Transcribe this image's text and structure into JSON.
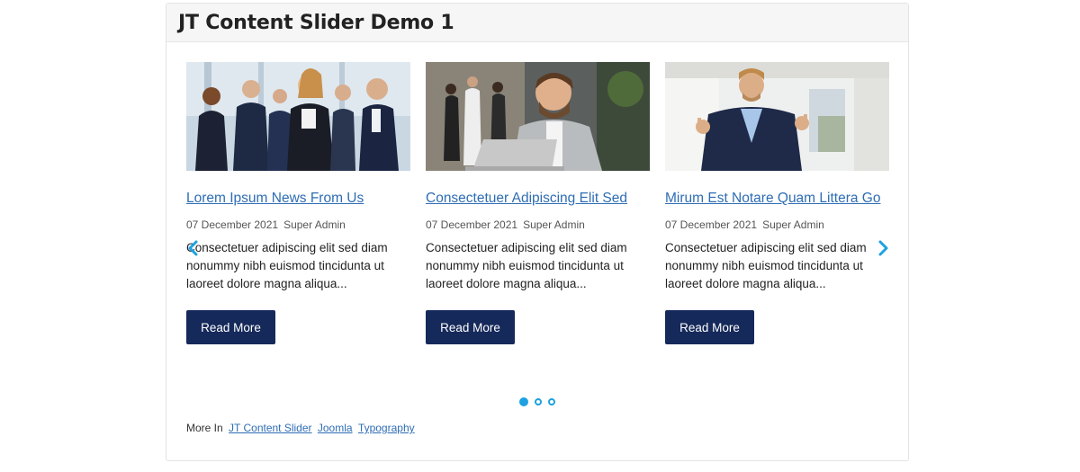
{
  "module": {
    "title": "JT Content Slider Demo 1"
  },
  "slides": [
    {
      "title": "Lorem Ipsum News From Us",
      "date": "07 December 2021",
      "author": "Super Admin",
      "text": "Consectetuer adipiscing elit sed diam nonummy nibh euismod tincidunta ut laoreet dolore magna aliqua...",
      "button": "Read More"
    },
    {
      "title": "Consectetuer Adipiscing Elit Sed",
      "date": "07 December 2021",
      "author": "Super Admin",
      "text": "Consectetuer adipiscing elit sed diam nonummy nibh euismod tincidunta ut laoreet dolore magna aliqua...",
      "button": "Read More"
    },
    {
      "title": "Mirum Est Notare Quam Littera Go",
      "date": "07 December 2021",
      "author": "Super Admin",
      "text": "Consectetuer adipiscing elit sed diam nonummy nibh euismod tincidunta ut laoreet dolore magna aliqua...",
      "button": "Read More"
    }
  ],
  "pagination": {
    "count": 3,
    "active": 1
  },
  "footer": {
    "prefix": "More In",
    "links": [
      "JT Content Slider",
      "Joomla",
      "Typography"
    ]
  },
  "colors": {
    "button_bg": "#15295a",
    "link": "#2e6db4",
    "accent": "#1da1e0"
  }
}
